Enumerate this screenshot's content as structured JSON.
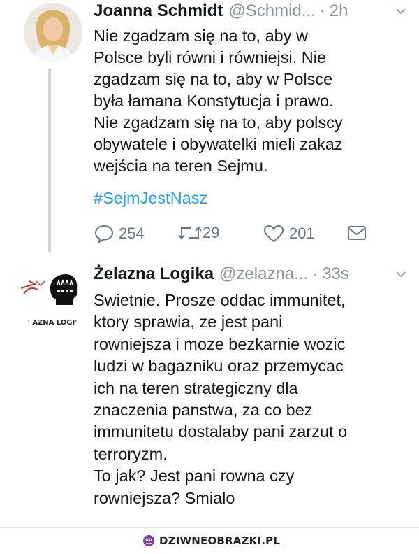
{
  "tweets": [
    {
      "name": "Joanna Schmidt",
      "handle": "@Schmid...",
      "separator": "·",
      "time": "2h",
      "text": "Nie zgadzam się na to, aby w\nPolsce byli równi i równiejsi. Nie\nzgadzam się na to, aby w Polsce\nbyła łamana Konstytucja i prawo.\nNie zgadzam się na to, aby polscy\nobywatele i obywatelki mieli zakaz\nwejścia na teren Sejmu.",
      "hashtag": "#SejmJestNasz",
      "actions": {
        "replies": "254",
        "retweets": "29",
        "likes": "201"
      }
    },
    {
      "name": "Żelazna Logika",
      "handle": "@zelazna...",
      "separator": "·",
      "time": "33s",
      "avatar_caption": "' AZNA LOGI'",
      "text": "Swietnie. Prosze oddac immunitet,\nktory sprawia, ze jest pani\nrowniejsza i moze bezkarnie wozic\nludzi w bagazniku oraz przemycac\nich na teren strategiczny dla\nznaczenia panstwa, za co bez\nimmunitetu dostalaby pani zarzut o\nterroryzm.\nTo jak? Jest pani rowna czy\nrowniejsza? Smialo"
    }
  ],
  "watermark": {
    "text": "DZIWNEOBRAZKI.PL"
  },
  "icons": {
    "reply": "reply-icon",
    "retweet": "retweet-icon",
    "like": "heart-icon",
    "dm": "envelope-icon",
    "caret": "chevron-down-icon",
    "brand": "brand-logo-icon"
  },
  "colors": {
    "link": "#1da1f2",
    "muted": "#8a9499",
    "text": "#14171a",
    "icon": "#657786",
    "brand": "#7b3fa0"
  }
}
